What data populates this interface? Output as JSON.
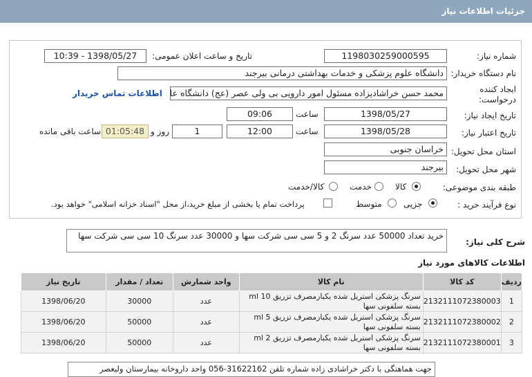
{
  "header": {
    "title": "جزئیات اطلاعات نیاز"
  },
  "form": {
    "need_number_label": "شماره نیاز:",
    "need_number": "1198030259000595",
    "announce_label": "تاریخ و ساعت اعلان عمومی:",
    "announce_value": "1398/05/27 - 10:39",
    "buyer_label": "نام دستگاه خریدار:",
    "buyer_value": "دانشگاه علوم پزشکی و خدمات بهداشتی درمانی بیرجند",
    "creator_label": "ایجاد کننده درخواست:",
    "creator_value": "محمد حسن خراشادیزاده مسئول امور دارویی بی ولی عصر (عج) دانشگاه علوم",
    "contact_link": "اطلاعات تماس خریدار",
    "created_date_label": "تاریخ ایجاد نیاز:",
    "created_date": "1398/05/27",
    "time_label": "ساعت",
    "created_time": "09:06",
    "validity_label": "تاریخ اعتبار نیاز:",
    "validity_date": "1398/05/28",
    "validity_time": "12:00",
    "days_value": "1",
    "days_label": "روز و",
    "remaining_time": "01:05:48",
    "remaining_label": "ساعت باقی مانده",
    "province_label": "استان محل تحویل:",
    "province_value": "خراسان جنوبی",
    "city_label": "شهر محل تحویل:",
    "city_value": "بیرجند",
    "category_label": "طبقه بندی موضوعی:",
    "category_options": [
      "کالا",
      "خدمت",
      "کالا/خدمت"
    ],
    "category_selected": "کالا",
    "process_label": "نوع فرآیند خرید :",
    "process_options": [
      "جزیی",
      "متوسط"
    ],
    "process_selected": "جزیی",
    "payment_note": "پرداخت تمام یا بخشی از مبلغ خرید،از محل \"اسناد خزانه اسلامی\" خواهد بود."
  },
  "description": {
    "label": "شرح کلی نیاز:",
    "text": "خرید تعداد 50000 عدد سرنگ 2 و 5 سی سی شرکت سها و 30000 عدد سرنگ 10 سی سی شرکت سها"
  },
  "goods": {
    "title": "اطلاعات کالاهای مورد نیاز",
    "columns": [
      "ردیف",
      "کد کالا",
      "نام کالا",
      "واحد شمارش",
      "تعداد / مقدار",
      "تاریخ نیاز"
    ],
    "rows": [
      {
        "row": "1",
        "code": "2132111072380003",
        "name": "سرنگ پزشکی استریل شده یکبارمصرف تزریق 10 ml بسته سلفونی سها",
        "unit": "عدد",
        "qty": "30000",
        "date": "1398/06/20"
      },
      {
        "row": "2",
        "code": "2132111072380002",
        "name": "سرنگ پزشکی استریل شده یکبارمصرف تزریق 5 ml بسته سلفونی سها",
        "unit": "عدد",
        "qty": "50000",
        "date": "1398/06/20"
      },
      {
        "row": "3",
        "code": "2132111072380001",
        "name": "سرنگ پزشکی استریل شده یکبارمصرف تزریق 2 ml بسته سلفونی سها",
        "unit": "عدد",
        "qty": "50000",
        "date": "1398/06/20"
      }
    ]
  },
  "footer": {
    "note": "جهت هماهنگی با دکتر خراشادی زاده شماره تلفن 31622162-056 واحد داروخانه بیمارستان ولیعصر"
  }
}
